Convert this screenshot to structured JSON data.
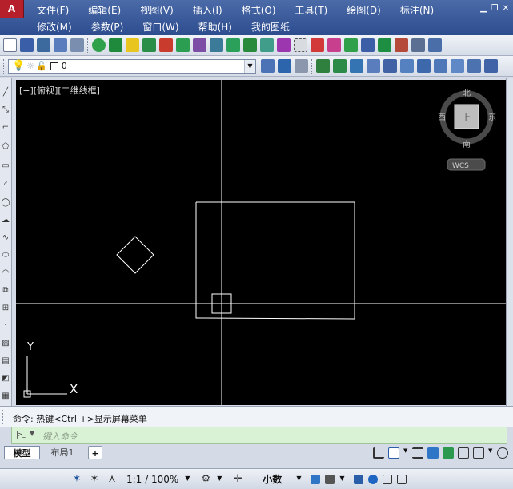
{
  "app": {
    "logo_text": "A"
  },
  "menu": {
    "row1": [
      "文件(F)",
      "编辑(E)",
      "视图(V)",
      "插入(I)",
      "格式(O)",
      "工具(T)",
      "绘图(D)",
      "标注(N)"
    ],
    "row2": [
      "修改(M)",
      "参数(P)",
      "窗口(W)",
      "帮助(H)",
      "我的图纸"
    ]
  },
  "layer": {
    "current": "0"
  },
  "viewport": {
    "label": "[−][俯视][二维线框]"
  },
  "viewcube": {
    "north": "北",
    "south": "南",
    "east": "东",
    "west": "西",
    "top_face": "上",
    "wcs_label": "WCS"
  },
  "ucs": {
    "y_label": "Y",
    "x_label": "X"
  },
  "command": {
    "history_text": "命令: 热键<Ctrl +>显示屏幕菜单",
    "input_placeholder": "键入命令"
  },
  "tabs": {
    "model": "模型",
    "layout1": "布局1",
    "add": "+"
  },
  "status": {
    "scale": "1:1 / 100%",
    "units": "小数"
  },
  "colors": {
    "canvas": "#000000",
    "menubar": "#2d4d8f",
    "command_input": "#d9f1d4",
    "drawing_lines": "#ffffff"
  }
}
